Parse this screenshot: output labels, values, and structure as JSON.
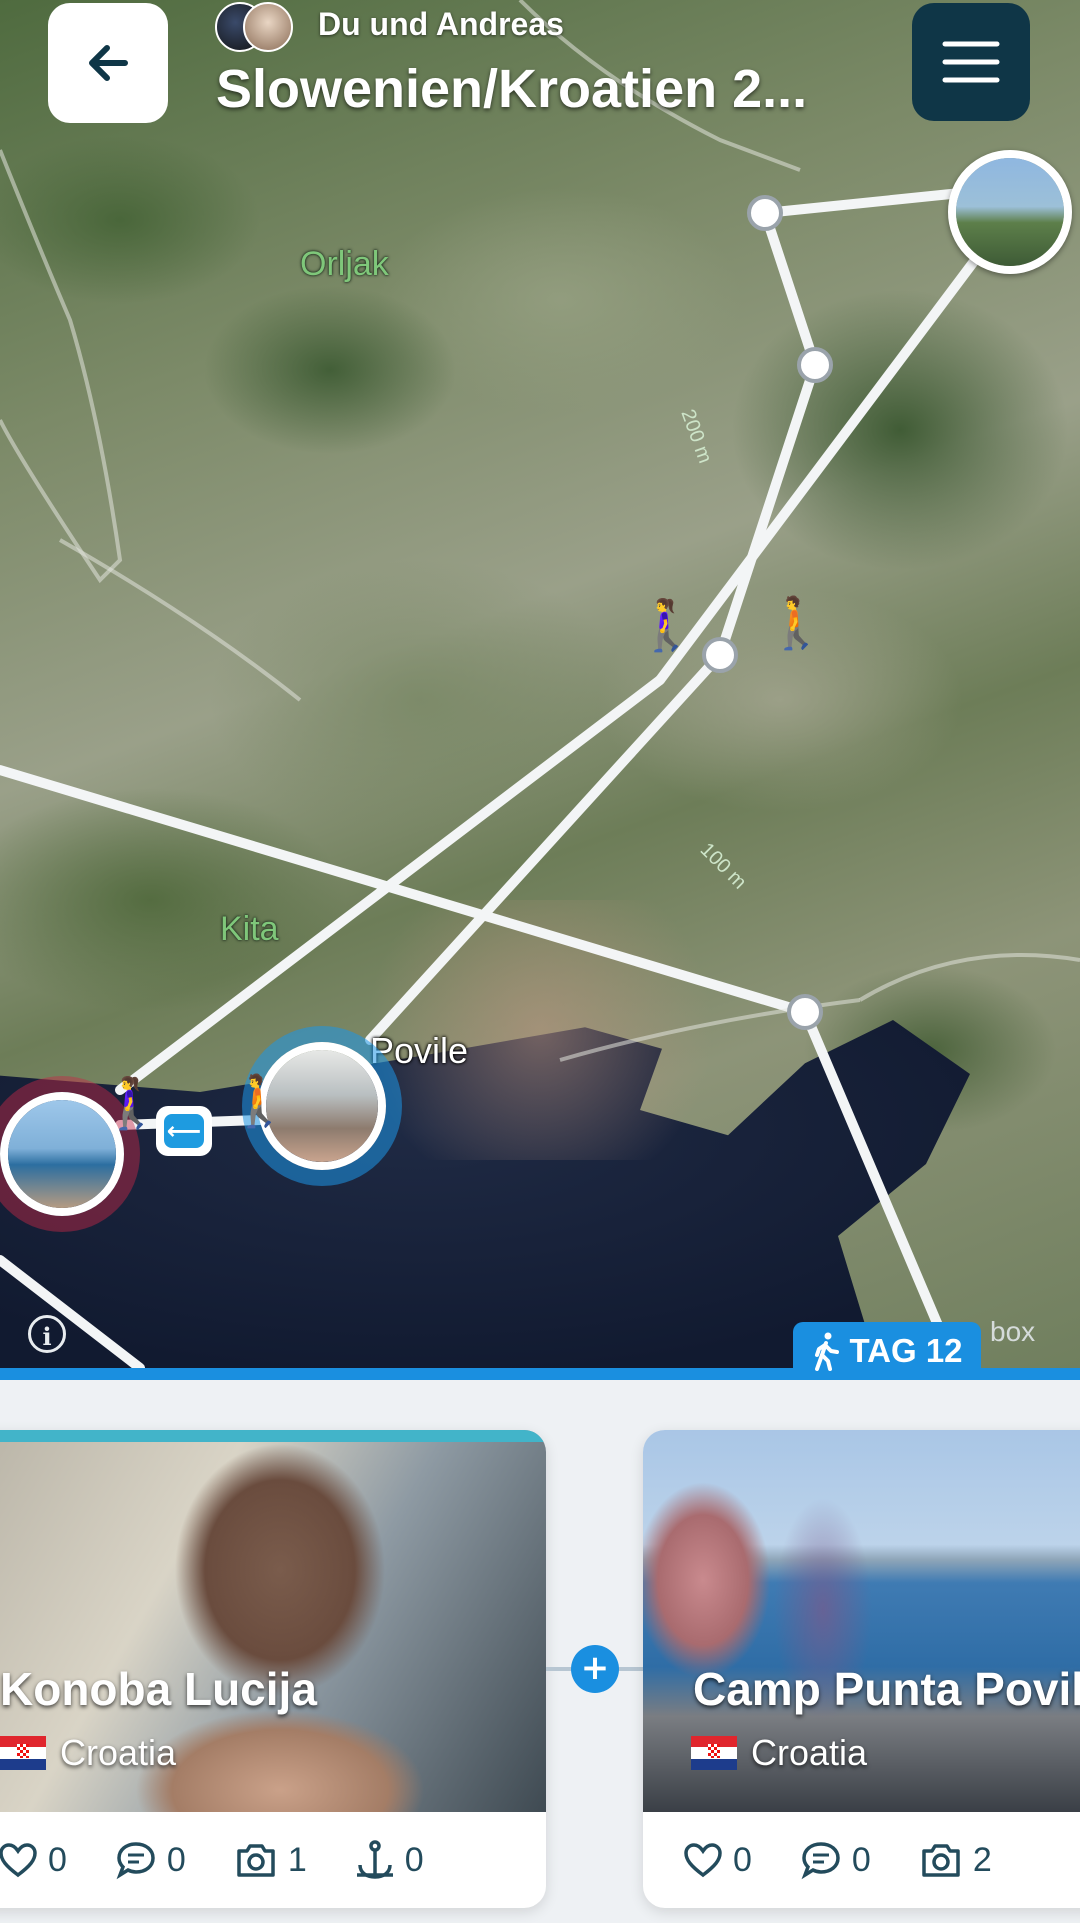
{
  "header": {
    "subtitle": "Du und Andreas",
    "title": "Slowenien/Kroatien 2..."
  },
  "map": {
    "labels": {
      "orljak": "Orljak",
      "kita": "Kita",
      "povile": "Povile",
      "contour_200": "200 m",
      "contour_100": "100 m"
    },
    "attribution": "box",
    "info": "i",
    "day_tab": "TAG 12"
  },
  "cards": [
    {
      "name": "Konoba Lucija",
      "country": "Croatia",
      "likes": "0",
      "comments": "0",
      "photos": "1",
      "anchors": "0"
    },
    {
      "name": "Camp Punta Povil",
      "country": "Croatia",
      "likes": "0",
      "comments": "0",
      "photos": "2"
    }
  ],
  "add_button": "+"
}
